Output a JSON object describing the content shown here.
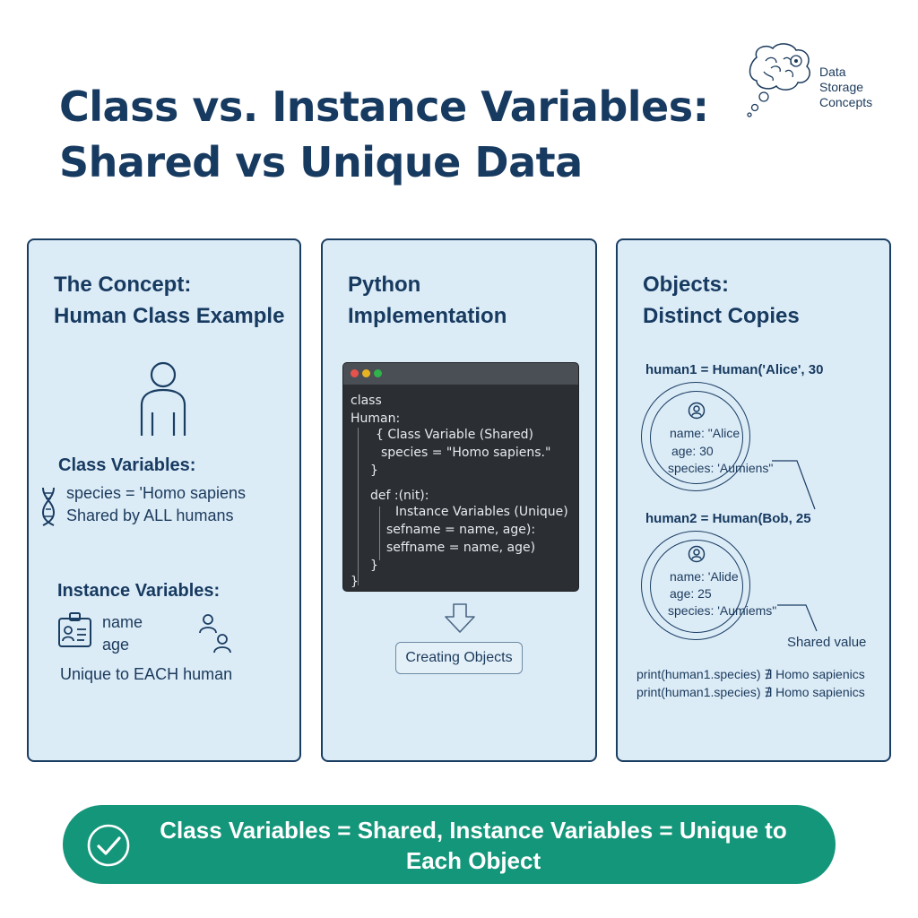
{
  "title": {
    "line1": "Class vs. Instance Variables:",
    "line2": "Shared vs Unique Data"
  },
  "brand": {
    "line1": "Data",
    "line2": "Storage",
    "line3": "Concepts",
    "icon": "brain-thought-bubble-icon"
  },
  "panel1": {
    "title_line1": "The Concept:",
    "title_line2": "Human Class Example",
    "class_vars_heading": "Class Variables:",
    "class_vars_line1": "species = 'Homo sapiens",
    "class_vars_line2": "Shared by ALL humans",
    "instance_vars_heading": "Instance Variables:",
    "instance_field1": "name",
    "instance_field2": "age",
    "instance_note": "Unique to EACH human"
  },
  "panel2": {
    "title_line1": "Python",
    "title_line2": "Implementation",
    "code": [
      "class",
      "Human:",
      "{ Class Variable (Shared)",
      "species = \"Homo sapiens.\"",
      "}",
      "def :(nit):",
      "Instance Variables (Unique)",
      "sefname = name, age):",
      "seffname = name, age)",
      "}",
      "}"
    ],
    "button_label": "Creating Objects",
    "window_dot_colors": [
      "#e5534b",
      "#e6b422",
      "#2fb34a"
    ]
  },
  "panel3": {
    "title_line1": "Objects:",
    "title_line2": "Distinct Copies",
    "obj1_header": "human1 = Human('Alice', 30",
    "obj1_name": "name: \"Alice",
    "obj1_age": "age: 30",
    "obj1_species": "species: 'Aumiens\"",
    "obj2_header": "human2 = Human(Bob, 25",
    "obj2_name": "name: 'Alide",
    "obj2_age": "age: 25",
    "obj2_species": "species: 'Aumiems\"",
    "shared_label": "Shared value",
    "print1": "print(human1.species) ∄ Homo sapienics",
    "print2": "print(human1.species) ∄ Homo sapienics"
  },
  "banner": {
    "line1": "Class Variables = Shared, Instance Variables = Unique to",
    "line2": "Each Object"
  },
  "colors": {
    "navy": "#173a60",
    "panel_bg": "#dcecf7",
    "banner_green": "#14967a",
    "code_bg": "#2b2f34"
  }
}
